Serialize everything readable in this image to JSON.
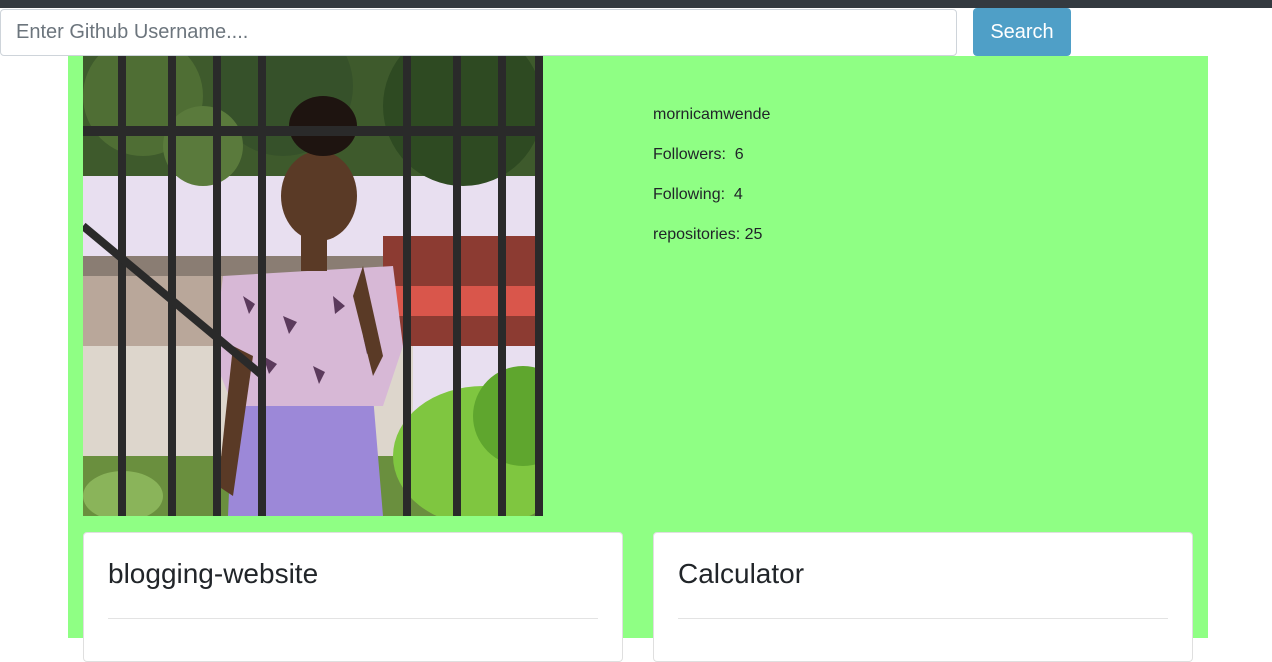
{
  "search": {
    "placeholder": "Enter Github Username....",
    "value": "",
    "button_label": "Search"
  },
  "profile": {
    "username": "mornicamwende",
    "followers_label": "Followers:",
    "followers": "6",
    "following_label": "Following:",
    "following": "4",
    "repos_label": "repositories:",
    "repos": "25"
  },
  "repos": [
    {
      "name": "blogging-website"
    },
    {
      "name": "Calculator"
    }
  ],
  "colors": {
    "panel_bg": "#8fff84",
    "search_button": "#4f9fc7",
    "topbar": "#343a40"
  }
}
